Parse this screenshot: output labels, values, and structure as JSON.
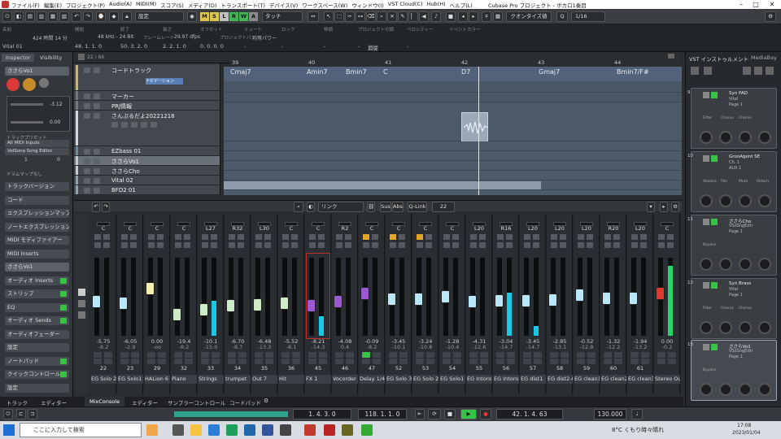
{
  "window": {
    "title": "Cubase Pro プロジェクト - ボカロ1奏目",
    "menu": [
      "ファイル(F)",
      "編集(E)",
      "プロジェクト(P)",
      "Audio(A)",
      "MIDI(M)",
      "スコア(S)",
      "メディア(D)",
      "トランスポート(T)",
      "デバイス(V)",
      "ワークスペース(W)",
      "ウィンドウ(I)",
      "VST Cloud(C)",
      "Hub(H)",
      "ヘルプ(L)"
    ]
  },
  "toolbar": {
    "preset": "設定",
    "touch": "タッチ",
    "quantize_mode": "クオンタイズ値",
    "quantize": "1/16",
    "mode_buttons": [
      "M",
      "S",
      "L",
      "R",
      "W",
      "A"
    ]
  },
  "infoline": {
    "headers": [
      "名前",
      "開始",
      "終了",
      "長さ",
      "オフセット",
      "ミュート",
      "ロック",
      "移調",
      "プロジェクトの調",
      "ベロシティー",
      "イベントカラー"
    ],
    "values": [
      "",
      "48. 1. 1. 0",
      "50. 3. 2. 0",
      "2. 2. 1. 0",
      "0. 0. 0. 0",
      "-",
      "-",
      "-",
      "-",
      "-",
      ""
    ],
    "status": [
      "424 時間 14 分",
      "48 kHz - 24 Bit",
      "フレームレート",
      "29.97 dfps",
      "プロジェクトパン",
      "均等パワー"
    ],
    "extra": "追従",
    "track_name": "Vital 01"
  },
  "inspector": {
    "tabs": [
      "Inspector",
      "Visibility"
    ],
    "track": "ささらVo1",
    "readouts": [
      "-3.12",
      "0.00",
      "1",
      "0"
    ],
    "sections": [
      "トラックバージョン",
      "コード",
      "エクスプレッションマップ",
      "ノートエクスプレッション",
      "MIDI モディファイアー",
      "MIDI Inserts",
      "ささらVo1",
      "オーディオ Inserts",
      "ストリップ",
      "EQ",
      "オーディオ Sends",
      "オーディオフェーダー",
      "設定",
      "ノートパッド",
      "クイックコントロール",
      "設定"
    ],
    "routing": [
      "トラックプリセット",
      "All MIDI Inputs",
      "VoiSona Song Editor",
      "ドラムマップなし"
    ]
  },
  "arrange": {
    "counter": "22 / 66",
    "ruler": [
      "39",
      "40",
      "41",
      "42",
      "43",
      "44"
    ],
    "tracks": [
      {
        "name": "コードトラック",
        "extra": "ナビゲーション"
      },
      {
        "name": "マーカー"
      },
      {
        "name": "PRJ情報"
      },
      {
        "name": "さんぷるだよ20221218"
      },
      {
        "name": "EZbass 01"
      },
      {
        "name": "ささらVo1"
      },
      {
        "name": "ささらCho"
      },
      {
        "name": "Vital 02"
      },
      {
        "name": "BFD2 01"
      }
    ],
    "chords": [
      "Cmaj7",
      "Amin7",
      "Bmin7",
      "C",
      "D7",
      "Gmaj7",
      "Bmin7/F#"
    ]
  },
  "mixer": {
    "routing": "リンク",
    "buttons": [
      "Sus",
      "Abs",
      "Q-Link"
    ],
    "zoom": "22",
    "channels": [
      {
        "num": "22",
        "name": "EG Solo 2",
        "pan": "C",
        "vol": "-5.75",
        "peak": "-8.2",
        "fader": 0.42,
        "meter": 0.0,
        "knob": "#b9e7f7"
      },
      {
        "num": "23",
        "name": "EG Solo1",
        "pan": "C",
        "vol": "-6.05",
        "peak": "-2.9",
        "fader": 0.4,
        "meter": 0.0,
        "knob": "#b9e7f7"
      },
      {
        "num": "29",
        "name": "HALion 6",
        "pan": "C",
        "vol": "0.00",
        "peak": "-oo",
        "fader": 0.62,
        "meter": 0.0,
        "knob": "#f2efb0"
      },
      {
        "num": "32",
        "name": "Piano",
        "pan": "C",
        "vol": "-19.4",
        "peak": "-8.2",
        "fader": 0.22,
        "meter": 0.0,
        "knob": "#cfeac6"
      },
      {
        "num": "33",
        "name": "Strings",
        "pan": "L27",
        "vol": "-10.1",
        "peak": "-15.0",
        "fader": 0.3,
        "meter": 0.45,
        "knob": "#cfeac6"
      },
      {
        "num": "34",
        "name": "trumpet",
        "pan": "R32",
        "vol": "-6.70",
        "peak": "-8.7",
        "fader": 0.36,
        "meter": 0.0,
        "knob": "#cfeac6"
      },
      {
        "num": "35",
        "name": "Out 7",
        "pan": "L30",
        "vol": "-6.48",
        "peak": "-13.3",
        "fader": 0.38,
        "meter": 0.0,
        "knob": "#cfeac6"
      },
      {
        "num": "36",
        "name": "Hit",
        "pan": "C",
        "vol": "-5.52",
        "peak": "-8.1",
        "fader": 0.4,
        "meter": 0.0,
        "knob": "#cfeac6"
      },
      {
        "num": "45",
        "name": "FX 1",
        "pan": "C",
        "vol": "-8.21",
        "peak": "-14.3",
        "fader": 0.36,
        "meter": 0.25,
        "knob": "#9b59d0"
      },
      {
        "num": "46",
        "name": "Vocorder",
        "pan": "R2",
        "vol": "-4.08",
        "peak": "0.4",
        "fader": 0.43,
        "meter": 0.0,
        "knob": "#9b59d0"
      },
      {
        "num": "47",
        "name": "Delay 1/4",
        "pan": "C",
        "vol": "-0.09",
        "peak": "-8.2",
        "fader": 0.55,
        "meter": 0.0,
        "knob": "#9b59d0"
      },
      {
        "num": "52",
        "name": "EG Solo 3",
        "pan": "C",
        "vol": "-3.45",
        "peak": "-10.1",
        "fader": 0.46,
        "meter": 0.0,
        "knob": "#b9e7f7"
      },
      {
        "num": "53",
        "name": "EG Solo 2",
        "pan": "C",
        "vol": "-3.24",
        "peak": "-10.8",
        "fader": 0.46,
        "meter": 0.0,
        "knob": "#b9e7f7"
      },
      {
        "num": "54",
        "name": "EG Solo1",
        "pan": "C",
        "vol": "-1.28",
        "peak": "-10.4",
        "fader": 0.5,
        "meter": 0.0,
        "knob": "#b9e7f7"
      },
      {
        "num": "55",
        "name": "EG Intoro1",
        "pan": "L20",
        "vol": "-4.31",
        "peak": "-12.6",
        "fader": 0.42,
        "meter": 0.0,
        "knob": "#b9e7f7"
      },
      {
        "num": "56",
        "name": "EG Intoro2",
        "pan": "R16",
        "vol": "-3.04",
        "peak": "-14.7",
        "fader": 0.44,
        "meter": 0.55,
        "knob": "#b9e7f7"
      },
      {
        "num": "57",
        "name": "EG dist1",
        "pan": "L20",
        "vol": "-3.45",
        "peak": "-14.7",
        "fader": 0.44,
        "meter": 0.12,
        "knob": "#b9e7f7"
      },
      {
        "num": "58",
        "name": "EG dist2-0",
        "pan": "L20",
        "vol": "-2.85",
        "peak": "-13.1",
        "fader": 0.45,
        "meter": 0.0,
        "knob": "#b9e7f7"
      },
      {
        "num": "59",
        "name": "EG clean1",
        "pan": "L20",
        "vol": "-0.52",
        "peak": "-12.8",
        "fader": 0.52,
        "meter": 0.0,
        "knob": "#b9e7f7"
      },
      {
        "num": "60",
        "name": "EG clean2",
        "pan": "R20",
        "vol": "-1.32",
        "peak": "-12.2",
        "fader": 0.48,
        "meter": 0.0,
        "knob": "#b9e7f7"
      },
      {
        "num": "61",
        "name": "EG clean3",
        "pan": "L20",
        "vol": "-1.94",
        "peak": "-13.2",
        "fader": 0.47,
        "meter": 0.0,
        "knob": "#b9e7f7"
      },
      {
        "num": "",
        "name": "Stereo Out",
        "pan": "C",
        "vol": "0.00",
        "peak": "-0.2",
        "fader": 0.55,
        "meter": 0.9,
        "knob": "#e03a2e"
      }
    ]
  },
  "vst": {
    "tabs": [
      "VST インストゥルメント",
      "MediaBay"
    ],
    "racks": [
      {
        "num": "9",
        "title": "Syn PAD",
        "sub": "Vital",
        "page": "Page 1",
        "params": [
          "Filter",
          "Chorus",
          "Chorus"
        ]
      },
      {
        "num": "10",
        "title": "GrooAgent SE",
        "sub": "Ch. 1",
        "page": "AUX 1",
        "params": [
          "Volume",
          "Pan",
          "Mute",
          "Return"
        ]
      },
      {
        "num": "11",
        "title": "ささらCho",
        "sub": "VSoSngEdtr",
        "page": "Page 1",
        "params": [
          "Bypass"
        ]
      },
      {
        "num": "12",
        "title": "Syn Brass",
        "sub": "Vital",
        "page": "Page 1",
        "params": [
          "Filter",
          "Chorus",
          "Chorus"
        ]
      },
      {
        "num": "13",
        "title": "ささらVo1",
        "sub": "VSoSngEdtr",
        "page": "Page 1",
        "params": [
          "Bypass"
        ]
      }
    ]
  },
  "bottomtabs": [
    "トラック",
    "エディター",
    "MixConsole",
    "エディター",
    "サンプラーコントロール",
    "コードパッド"
  ],
  "transport": {
    "left": "1. 4. 3. 0",
    "right": "118. 1. 1. 0",
    "position": "42. 1. 4. 63",
    "tempo": "130.000"
  },
  "taskbar": {
    "search": "ここに入力して検索",
    "weather": "8°C くもり時々晴れ",
    "time": "17:08",
    "date": "2023/01/04"
  }
}
